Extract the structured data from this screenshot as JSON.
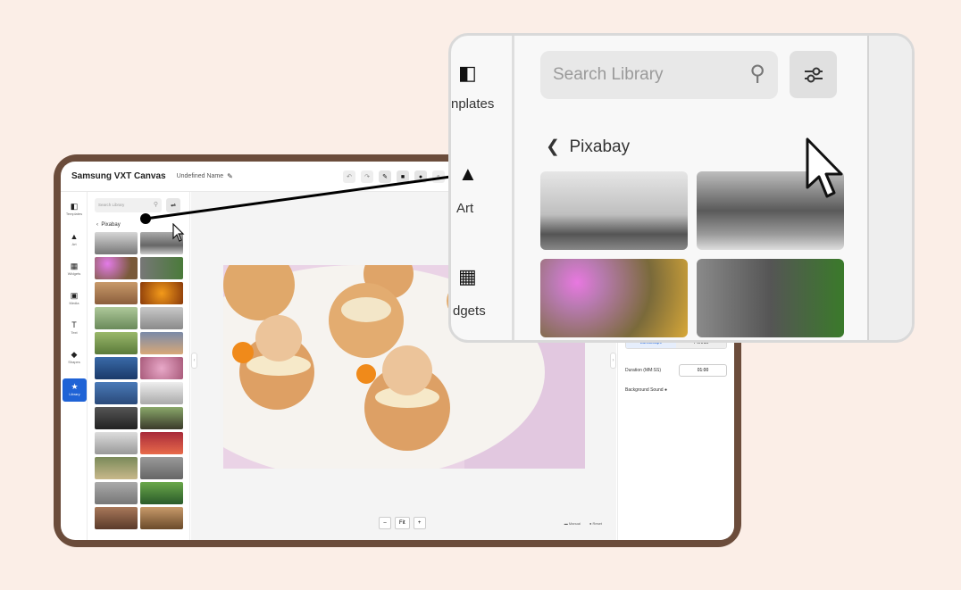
{
  "app": {
    "title": "Samsung VXT Canvas",
    "document_name": "Undefined Name"
  },
  "nav": {
    "items": [
      {
        "label": "Templates",
        "icon": "templates-icon"
      },
      {
        "label": "Art",
        "icon": "art-icon"
      },
      {
        "label": "Widgets",
        "icon": "widgets-icon"
      },
      {
        "label": "Media",
        "icon": "media-icon"
      },
      {
        "label": "Text",
        "icon": "text-icon"
      },
      {
        "label": "Shapes",
        "icon": "shapes-icon"
      },
      {
        "label": "Library",
        "icon": "library-star-icon",
        "active": true
      }
    ]
  },
  "library": {
    "search_placeholder": "Search Library",
    "back_label": "Pixabay"
  },
  "canvas": {
    "zoom_label": "Fit",
    "bottom_left_option": "Manual",
    "bottom_right_option": "Reset"
  },
  "right_panel": {
    "orientation_landscape": "Landscape",
    "orientation_portrait": "Portrait",
    "duration_label": "Duration (MM:SS)",
    "duration_value": "01:00",
    "background_sound_label": "Background Sound"
  },
  "zoom_callout": {
    "nav_templates_partial": "nplates",
    "nav_art": "Art",
    "nav_widgets_partial": "dgets",
    "search_placeholder": "Search Library",
    "back_label": "Pixabay"
  },
  "colors": {
    "background": "#fbeee7",
    "tablet_frame": "#6b4c3b",
    "accent": "#1f63d6"
  }
}
